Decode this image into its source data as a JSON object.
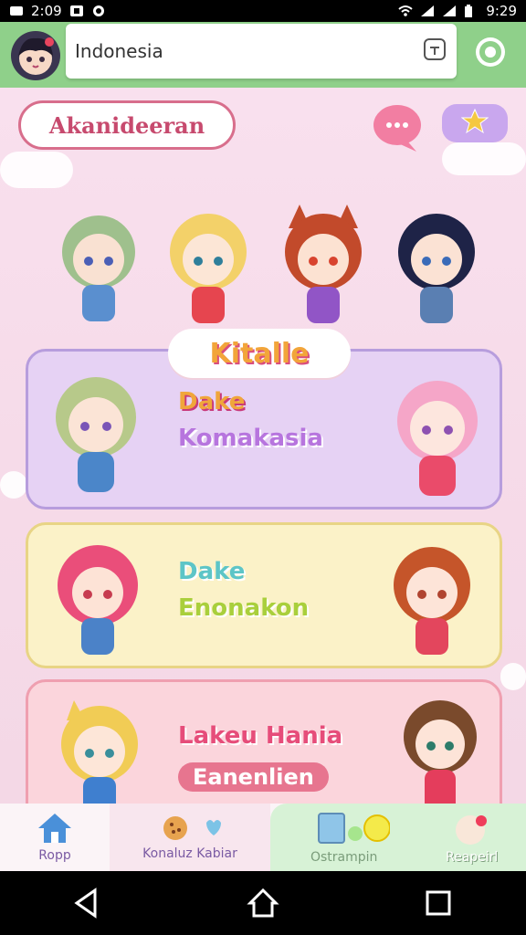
{
  "status": {
    "time_left": "2:09",
    "time_right": "9:29"
  },
  "header": {
    "search_value": "Indonesia",
    "search_action_icon": "translate-icon",
    "settings_icon": "gear-icon",
    "colors": {
      "appbar": "#8fd08a"
    }
  },
  "main": {
    "banner_label": "Akanideeran",
    "section_title": "Kitalle",
    "cards": [
      {
        "line1": "Dake",
        "line2": "Komakasia"
      },
      {
        "line1": "Dake",
        "line2": "Enonakon"
      },
      {
        "line1": "Lakeu Hania",
        "pill": "Eanenlien"
      }
    ]
  },
  "bottom_nav": {
    "home_label": "Ropp",
    "mid_label": "Konaluz Kabiar",
    "green_left_label": "Ostrampin",
    "green_right_label": "Reapeirl"
  }
}
